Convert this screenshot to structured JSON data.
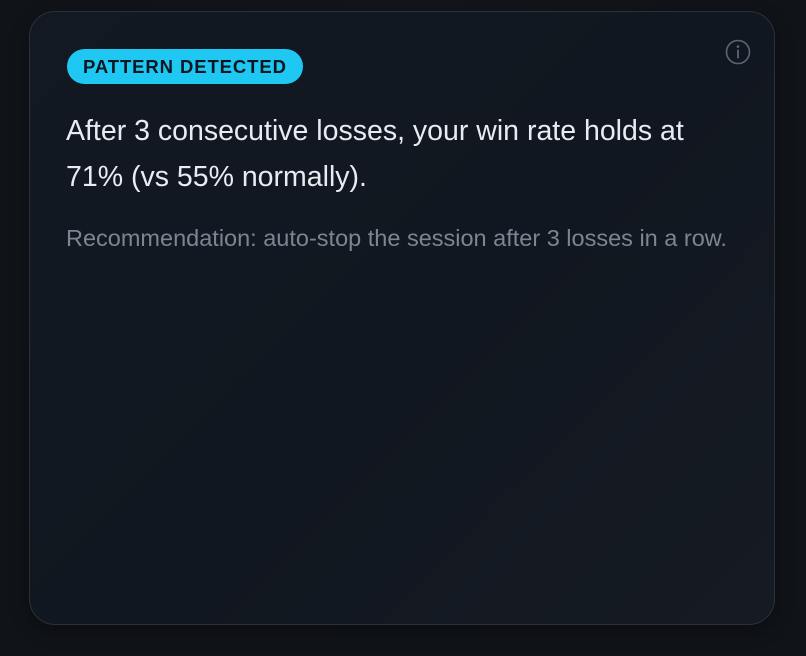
{
  "insight_card": {
    "badge_label": "PATTERN DETECTED",
    "info_icon": "info-icon",
    "headline": "After 3 consecutive losses, your win rate holds at 71% (vs 55% normally).",
    "recommendation": "Recommendation: auto-stop the session after 3 losses in a row."
  },
  "colors": {
    "page_background": "#111419",
    "card_background": "#121821",
    "card_border": "#2a313b",
    "badge_background": "#1ec8f2",
    "badge_text": "#0b1620",
    "headline_text": "#e8ebef",
    "recommendation_text": "#7d8591",
    "icon": "#5e6672"
  }
}
